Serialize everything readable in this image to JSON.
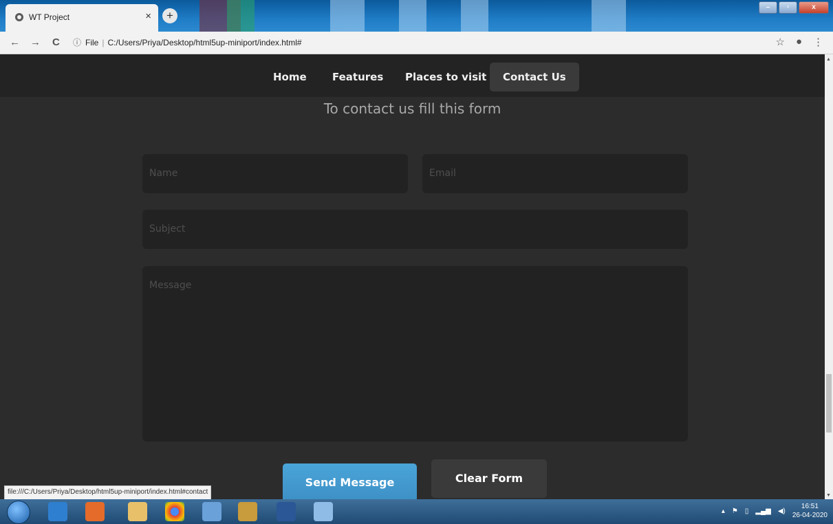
{
  "browser": {
    "tab_title": "WT Project",
    "tab_close": "×",
    "new_tab": "+",
    "back": "←",
    "forward": "→",
    "reload": "C",
    "info_icon": "ⓘ",
    "scheme_label": "File",
    "url": "C:/Users/Priya/Desktop/html5up-miniport/index.html#",
    "star": "☆",
    "menu": "⋮",
    "status_url": "file:///C:/Users/Priya/Desktop/html5up-miniport/index.html#contact"
  },
  "nav": {
    "items": [
      {
        "label": "Home"
      },
      {
        "label": "Features"
      },
      {
        "label": "Places to visit"
      },
      {
        "label": "Contact Us",
        "active": true
      }
    ]
  },
  "contact": {
    "heading": "To contact us fill this form",
    "name_placeholder": "Name",
    "email_placeholder": "Email",
    "subject_placeholder": "Subject",
    "message_placeholder": "Message",
    "send_label": "Send Message",
    "clear_label": "Clear Form"
  },
  "taskbar": {
    "time": "16:51",
    "date": "26-04-2020"
  }
}
